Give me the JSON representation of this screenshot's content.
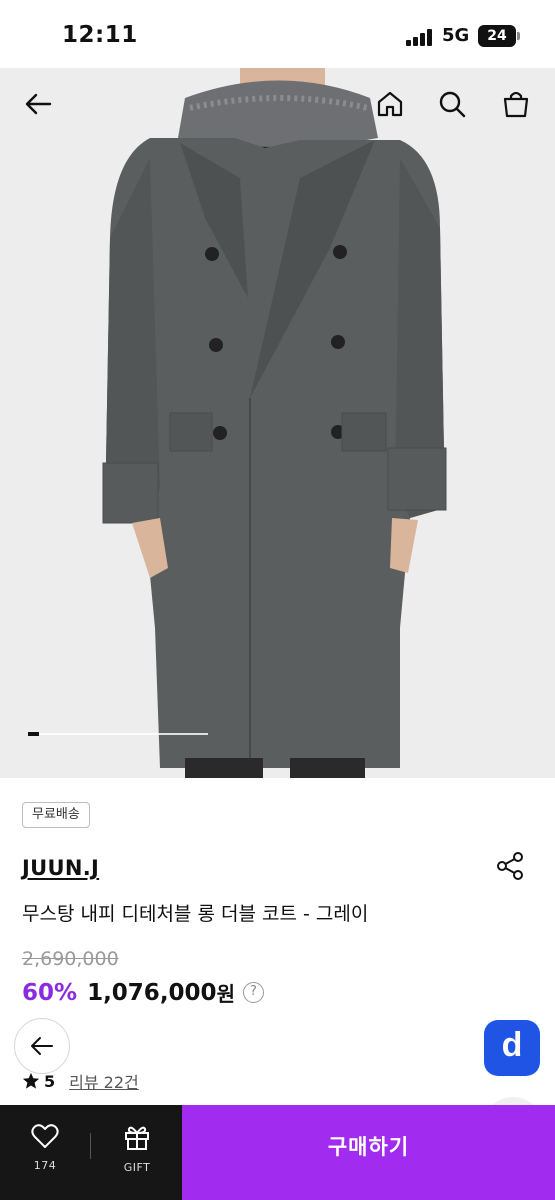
{
  "status": {
    "time": "12:11",
    "network": "5G",
    "battery": "24"
  },
  "header": {
    "back_icon": "arrow-left-icon",
    "home_icon": "home-icon",
    "search_icon": "search-icon",
    "cart_icon": "shopping-bag-icon"
  },
  "product": {
    "badge": "무료배송",
    "brand": "JUUN.J",
    "name": "무스탕 내피 디테처블 롱 더블 코트 - 그레이",
    "original_price": "2,690,000",
    "discount": "60%",
    "price": "1,076,000",
    "currency": "원",
    "help": "?",
    "rating": "5",
    "reviews": "리뷰 22건",
    "image_slide": {
      "current": 1,
      "progress": 0.06
    }
  },
  "bottom_bar": {
    "like_count": "174",
    "gift_label": "GIFT",
    "buy_label": "구매하기"
  },
  "floating": {
    "app_letter": "d"
  },
  "colors": {
    "accent": "#8a2be2",
    "buy_button": "#a12cf0",
    "app_badge": "#1f54e5",
    "coat": "#5b5e5f"
  }
}
